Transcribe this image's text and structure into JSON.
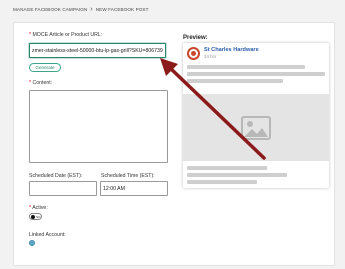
{
  "breadcrumb": {
    "parent": "MANAGE FACEBOOK CAMPAIGN",
    "separator": "›",
    "current": "NEW FACEBOOK POST"
  },
  "form": {
    "url_label": "MOCE Article or Product URL:",
    "url_value": "zmer-stainless-steel-50000-btu-lp-gas-grill?SKU=806739",
    "generate_label": "Generate",
    "content_label": "Content:",
    "content_value": "",
    "date_label": "Scheduled Date (EST):",
    "date_value": "",
    "time_label": "Scheduled Time (EST):",
    "time_value": "12:00 AM",
    "active_label": "Active:",
    "active_value": "NO",
    "linked_label": "Linked Account:",
    "required_marker": "*"
  },
  "preview": {
    "label": "Preview:",
    "page_name": "St Charles Hardware",
    "time": "34 hrs"
  },
  "colors": {
    "arrow": "#8b1a1a",
    "accent": "#2a8a70",
    "page_name": "#2b5ea8",
    "avatar": "#c8472e"
  }
}
